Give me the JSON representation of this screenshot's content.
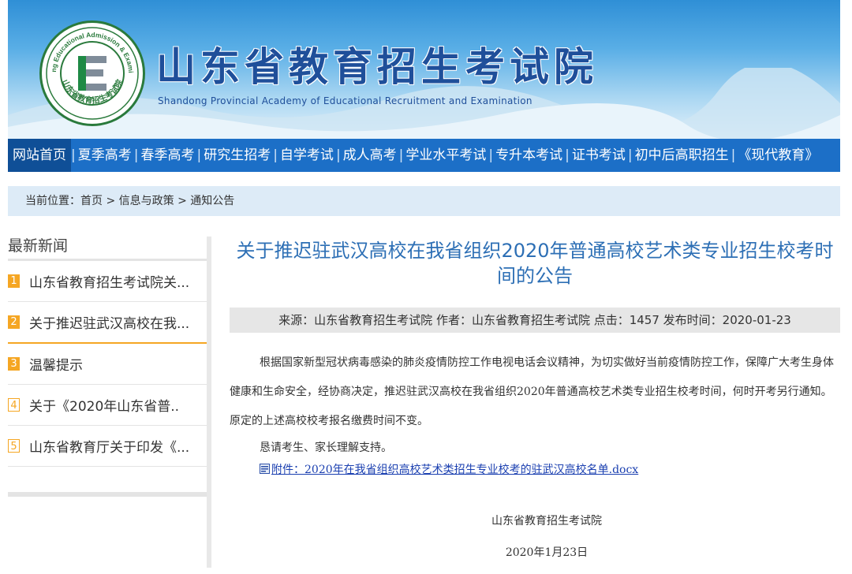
{
  "header": {
    "logo_ring_text": "Shandong Educational Admission & Examinations",
    "logo_bottom_text": "山东省教育招生考试院",
    "title": "山东省教育招生考试院",
    "subtitle": "Shandong Provincial Academy of Educational Recruitment and Examination"
  },
  "nav": {
    "items": [
      {
        "label": "网站首页",
        "active": true
      },
      {
        "label": "夏季高考"
      },
      {
        "label": "春季高考"
      },
      {
        "label": "研究生招考"
      },
      {
        "label": "自学考试"
      },
      {
        "label": "成人高考"
      },
      {
        "label": "学业水平考试"
      },
      {
        "label": "专升本考试"
      },
      {
        "label": "证书考试"
      },
      {
        "label": "初中后高职招生"
      },
      {
        "label": "《现代教育》"
      }
    ],
    "separator": "|"
  },
  "breadcrumb": {
    "prefix": "当前位置：",
    "items": [
      "首页",
      "信息与政策",
      "通知公告"
    ],
    "separator": " > "
  },
  "sidebar": {
    "heading": "最新新闻",
    "items": [
      {
        "num": "1",
        "label": "山东省教育招生考试院关..."
      },
      {
        "num": "2",
        "label": "关于推迟驻武汉高校在我..."
      },
      {
        "num": "3",
        "label": "温馨提示"
      },
      {
        "num": "4",
        "label": "关于《2020年山东省普.."
      },
      {
        "num": "5",
        "label": "山东省教育厅关于印发《..."
      }
    ]
  },
  "article": {
    "title": "关于推迟驻武汉高校在我省组织2020年普通高校艺术类专业招生校考时间的公告",
    "meta": "来源：山东省教育招生考试院 作者：山东省教育招生考试院 点击：1457 发布时间：2020-01-23",
    "paragraph1": "根据国家新型冠状病毒感染的肺炎疫情防控工作电视电话会议精神，为切实做好当前疫情防控工作，保障广大考生身体健康和生命安全，经协商决定，推迟驻武汉高校在我省组织2020年普通高校艺术类专业招生校考时间，何时开考另行通知。原定的上述高校校考报名缴费时间不变。",
    "paragraph2": "恳请考生、家长理解支持。",
    "attachment": "附件：2020年在我省组织高校艺术类招生专业校考的驻武汉高校名单.docx",
    "signature": "山东省教育招生考试院",
    "date": "2020年1月23日"
  },
  "colors": {
    "nav_bg": "#1c6fc7",
    "nav_active_bg": "#0f4f97",
    "title_blue": "#2d6fb5",
    "accent_orange": "#f5a623",
    "breadcrumb_bg": "#ddebf7",
    "meta_bg": "#e6e6e6"
  }
}
